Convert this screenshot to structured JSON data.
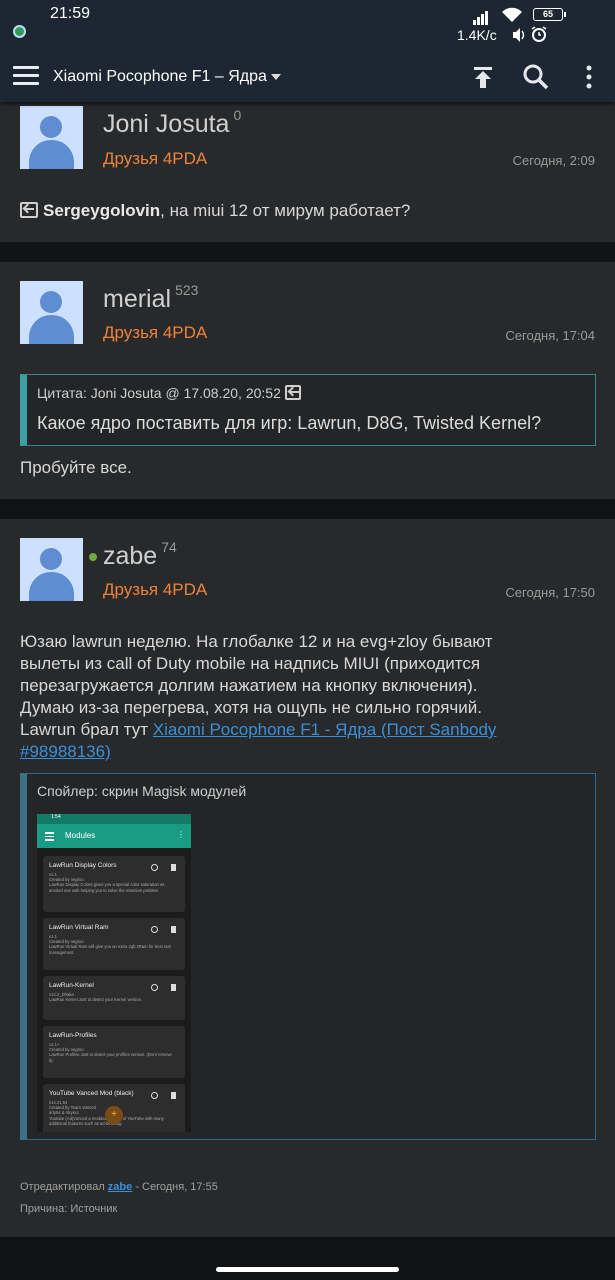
{
  "status_bar": {
    "time": "21:59",
    "net_speed": "1.4K/c",
    "battery": "65"
  },
  "toolbar": {
    "title": "Xiaomi Pocophone F1 – Ядра"
  },
  "posts": [
    {
      "author": "Joni Josuta",
      "reputation": "0",
      "group": "Друзья 4PDA",
      "time": "Сегодня, 2:09",
      "reply_to": "Sergeygolovin",
      "text": ", на miui 12 от мирум работает?"
    },
    {
      "author": "merial",
      "reputation": "523",
      "group": "Друзья 4PDA",
      "time": "Сегодня, 17:04",
      "quote_head": "Цитата: Joni Josuta @ 17.08.20, 20:52",
      "quote_text": "Какое ядро поставить для игр: Lawrun, D8G, Twisted Kernel?",
      "text": "Пробуйте все."
    },
    {
      "author": "zabe",
      "reputation": "74",
      "group": "Друзья 4PDA",
      "time": "Сегодня, 17:50",
      "text_lines": [
        "Юзаю lawrun неделю. На глобалке 12 и на evg+zloy бывают",
        "вылеты из call of Duty mobile на надпись MIUI (приходится",
        "перезагружается долгим нажатием на кнопку включения).",
        "Думаю из-за перегрева, хотя на ощупь не сильно горячий.",
        "Lawrun брал тут "
      ],
      "link_line1": "Xiaomi Pocophone F1 - Ядра (Пост Sanbody",
      "link_line2": "#98988136)",
      "spoiler_title": "Спойлер: скрин Magisk модулей",
      "edited_prefix": "Отредактировал ",
      "edited_by": "zabe",
      "edited_suffix": " - Сегодня, 17:55",
      "reason": "Причина: Источник"
    }
  ],
  "magisk": {
    "status_time": "1:54",
    "title": "Modules",
    "modules": [
      {
        "name": "LawRun Display Colors",
        "meta": "v1.1\nCreated by negroo\nLawRun Display Colors gives you a special color saturation as amoled one with helping you to solve the retention problem"
      },
      {
        "name": "LawRun Virtual Ram",
        "meta": "v1.1\nCreated by negroo\nLawRun Virtual Ram will give you an extra 2gb zRam for best ram management."
      },
      {
        "name": "LawRun-Kernel",
        "meta": "v13.2_Dhaka\nLawRun Kernel Just to detect your Kernel version."
      },
      {
        "name": "LawRun-Profiles",
        "meta": "v1.1+\nCreated by negroo\nLawRun Profiles Just to detect your profiles version. (Dont remove it)."
      },
      {
        "name": "YouTube Vanced Mod (black)",
        "meta": "v14.21.54\nCreated by Team Vanced\narty54 & Skyscc\nYoutube (Ad)Vanced a modded version of YouTube with many additional features such as ad-blocking"
      }
    ],
    "fab": "+"
  }
}
